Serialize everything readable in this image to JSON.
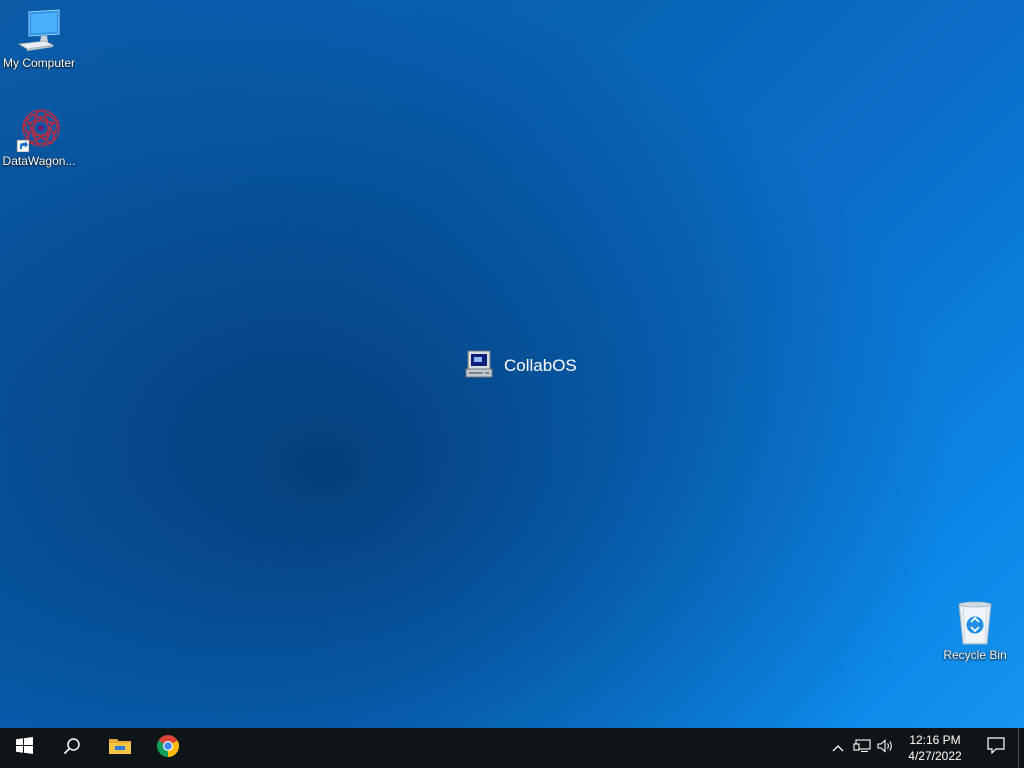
{
  "desktop": {
    "icons": [
      {
        "id": "my-computer",
        "label": "My Computer"
      },
      {
        "id": "datawagon",
        "label": "DataWagon..."
      },
      {
        "id": "recycle-bin",
        "label": "Recycle Bin"
      }
    ],
    "splash": {
      "label": "CollabOS",
      "icon": "computer-terminal-icon"
    }
  },
  "taskbar": {
    "start_icon": "windows-logo-icon",
    "search_icon": "search-icon",
    "pinned": [
      {
        "name": "File Explorer",
        "icon": "folder-icon"
      },
      {
        "name": "Google Chrome",
        "icon": "chrome-icon"
      }
    ],
    "tray": {
      "chevron_icon": "chevron-up-icon",
      "network_icon": "network-icon",
      "volume_icon": "volume-icon",
      "time": "12:16 PM",
      "date": "4/27/2022",
      "notification_icon": "action-center-icon"
    }
  },
  "colors": {
    "taskbar_bg": "#0f1418",
    "desktop_accent": "#0b78d7"
  }
}
